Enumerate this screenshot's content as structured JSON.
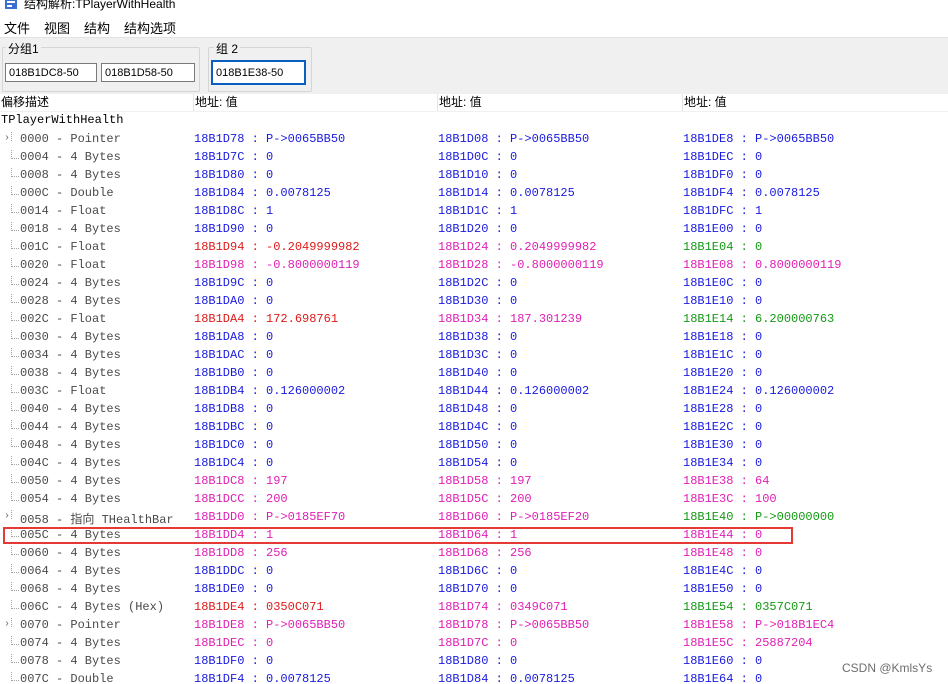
{
  "window": {
    "title": "结构解析:TPlayerWithHealth",
    "menu": [
      "文件",
      "视图",
      "结构",
      "结构选项"
    ]
  },
  "groups": [
    {
      "label": "分组1",
      "addresses": [
        "018B1DC8-50",
        "018B1D58-50"
      ]
    },
    {
      "label": "组 2",
      "addresses": [
        "018B1E38-50"
      ]
    }
  ],
  "columns": {
    "desc_header": "偏移描述",
    "value_headers": [
      "地址: 值",
      "地址: 值",
      "地址: 值"
    ]
  },
  "tree": {
    "root": "TPlayerWithHealth",
    "rows": [
      {
        "desc": "0000 - Pointer",
        "exp": true,
        "cells": [
          [
            "18B1D78 : P->0065BB50",
            "blue"
          ],
          [
            "18B1D08 : P->0065BB50",
            "blue"
          ],
          [
            "18B1DE8 : P->0065BB50",
            "blue"
          ]
        ]
      },
      {
        "desc": "0004 - 4 Bytes",
        "cells": [
          [
            "18B1D7C : 0",
            "blue"
          ],
          [
            "18B1D0C : 0",
            "blue"
          ],
          [
            "18B1DEC : 0",
            "blue"
          ]
        ]
      },
      {
        "desc": "0008 - 4 Bytes",
        "cells": [
          [
            "18B1D80 : 0",
            "blue"
          ],
          [
            "18B1D10 : 0",
            "blue"
          ],
          [
            "18B1DF0 : 0",
            "blue"
          ]
        ]
      },
      {
        "desc": "000C - Double",
        "cells": [
          [
            "18B1D84 : 0.0078125",
            "blue"
          ],
          [
            "18B1D14 : 0.0078125",
            "blue"
          ],
          [
            "18B1DF4 : 0.0078125",
            "blue"
          ]
        ]
      },
      {
        "desc": "0014 - Float",
        "cells": [
          [
            "18B1D8C : 1",
            "blue"
          ],
          [
            "18B1D1C : 1",
            "blue"
          ],
          [
            "18B1DFC : 1",
            "blue"
          ]
        ]
      },
      {
        "desc": "0018 - 4 Bytes",
        "cells": [
          [
            "18B1D90 : 0",
            "blue"
          ],
          [
            "18B1D20 : 0",
            "blue"
          ],
          [
            "18B1E00 : 0",
            "blue"
          ]
        ]
      },
      {
        "desc": "001C - Float",
        "cells": [
          [
            "18B1D94 : -0.2049999982",
            "red"
          ],
          [
            "18B1D24 : 0.2049999982",
            "pink"
          ],
          [
            "18B1E04 : 0",
            "green"
          ]
        ]
      },
      {
        "desc": "0020 - Float",
        "cells": [
          [
            "18B1D98 : -0.8000000119",
            "pink"
          ],
          [
            "18B1D28 : -0.8000000119",
            "pink"
          ],
          [
            "18B1E08 : 0.8000000119",
            "pink"
          ]
        ]
      },
      {
        "desc": "0024 - 4 Bytes",
        "cells": [
          [
            "18B1D9C : 0",
            "blue"
          ],
          [
            "18B1D2C : 0",
            "blue"
          ],
          [
            "18B1E0C : 0",
            "blue"
          ]
        ]
      },
      {
        "desc": "0028 - 4 Bytes",
        "cells": [
          [
            "18B1DA0 : 0",
            "blue"
          ],
          [
            "18B1D30 : 0",
            "blue"
          ],
          [
            "18B1E10 : 0",
            "blue"
          ]
        ]
      },
      {
        "desc": "002C - Float",
        "cells": [
          [
            "18B1DA4 : 172.698761",
            "red"
          ],
          [
            "18B1D34 : 187.301239",
            "pink"
          ],
          [
            "18B1E14 : 6.200000763",
            "green"
          ]
        ]
      },
      {
        "desc": "0030 - 4 Bytes",
        "cells": [
          [
            "18B1DA8 : 0",
            "blue"
          ],
          [
            "18B1D38 : 0",
            "blue"
          ],
          [
            "18B1E18 : 0",
            "blue"
          ]
        ]
      },
      {
        "desc": "0034 - 4 Bytes",
        "cells": [
          [
            "18B1DAC : 0",
            "blue"
          ],
          [
            "18B1D3C : 0",
            "blue"
          ],
          [
            "18B1E1C : 0",
            "blue"
          ]
        ]
      },
      {
        "desc": "0038 - 4 Bytes",
        "cells": [
          [
            "18B1DB0 : 0",
            "blue"
          ],
          [
            "18B1D40 : 0",
            "blue"
          ],
          [
            "18B1E20 : 0",
            "blue"
          ]
        ]
      },
      {
        "desc": "003C - Float",
        "cells": [
          [
            "18B1DB4 : 0.126000002",
            "blue"
          ],
          [
            "18B1D44 : 0.126000002",
            "blue"
          ],
          [
            "18B1E24 : 0.126000002",
            "blue"
          ]
        ]
      },
      {
        "desc": "0040 - 4 Bytes",
        "cells": [
          [
            "18B1DB8 : 0",
            "blue"
          ],
          [
            "18B1D48 : 0",
            "blue"
          ],
          [
            "18B1E28 : 0",
            "blue"
          ]
        ]
      },
      {
        "desc": "0044 - 4 Bytes",
        "cells": [
          [
            "18B1DBC : 0",
            "blue"
          ],
          [
            "18B1D4C : 0",
            "blue"
          ],
          [
            "18B1E2C : 0",
            "blue"
          ]
        ]
      },
      {
        "desc": "0048 - 4 Bytes",
        "cells": [
          [
            "18B1DC0 : 0",
            "blue"
          ],
          [
            "18B1D50 : 0",
            "blue"
          ],
          [
            "18B1E30 : 0",
            "blue"
          ]
        ]
      },
      {
        "desc": "004C - 4 Bytes",
        "cells": [
          [
            "18B1DC4 : 0",
            "blue"
          ],
          [
            "18B1D54 : 0",
            "blue"
          ],
          [
            "18B1E34 : 0",
            "blue"
          ]
        ]
      },
      {
        "desc": "0050 - 4 Bytes",
        "cells": [
          [
            "18B1DC8 : 197",
            "pink"
          ],
          [
            "18B1D58 : 197",
            "pink"
          ],
          [
            "18B1E38 : 64",
            "pink"
          ]
        ]
      },
      {
        "desc": "0054 - 4 Bytes",
        "cells": [
          [
            "18B1DCC : 200",
            "pink"
          ],
          [
            "18B1D5C : 200",
            "pink"
          ],
          [
            "18B1E3C : 100",
            "pink"
          ]
        ]
      },
      {
        "desc": "0058 - 指向 THealthBar",
        "exp": true,
        "cells": [
          [
            "18B1DD0 : P->0185EF70",
            "pink"
          ],
          [
            "18B1D60 : P->0185EF20",
            "pink"
          ],
          [
            "18B1E40 : P->00000000",
            "green"
          ]
        ]
      },
      {
        "desc": "005C - 4 Bytes",
        "cells": [
          [
            "18B1DD4 : 1",
            "pink"
          ],
          [
            "18B1D64 : 1",
            "pink"
          ],
          [
            "18B1E44 : 0",
            "pink"
          ]
        ]
      },
      {
        "desc": "0060 - 4 Bytes",
        "cells": [
          [
            "18B1DD8 : 256",
            "pink"
          ],
          [
            "18B1D68 : 256",
            "pink"
          ],
          [
            "18B1E48 : 0",
            "pink"
          ]
        ]
      },
      {
        "desc": "0064 - 4 Bytes",
        "cells": [
          [
            "18B1DDC : 0",
            "blue"
          ],
          [
            "18B1D6C : 0",
            "blue"
          ],
          [
            "18B1E4C : 0",
            "blue"
          ]
        ]
      },
      {
        "desc": "0068 - 4 Bytes",
        "cells": [
          [
            "18B1DE0 : 0",
            "blue"
          ],
          [
            "18B1D70 : 0",
            "blue"
          ],
          [
            "18B1E50 : 0",
            "blue"
          ]
        ]
      },
      {
        "desc": "006C - 4 Bytes (Hex)",
        "cells": [
          [
            "18B1DE4 : 0350C071",
            "red"
          ],
          [
            "18B1D74 : 0349C071",
            "pink"
          ],
          [
            "18B1E54 : 0357C071",
            "green"
          ]
        ]
      },
      {
        "desc": "0070 - Pointer",
        "exp": true,
        "cells": [
          [
            "18B1DE8 : P->0065BB50",
            "pink"
          ],
          [
            "18B1D78 : P->0065BB50",
            "pink"
          ],
          [
            "18B1E58 : P->018B1EC4",
            "pink"
          ]
        ]
      },
      {
        "desc": "0074 - 4 Bytes",
        "cells": [
          [
            "18B1DEC : 0",
            "pink"
          ],
          [
            "18B1D7C : 0",
            "pink"
          ],
          [
            "18B1E5C : 25887204",
            "pink"
          ]
        ]
      },
      {
        "desc": "0078 - 4 Bytes",
        "cells": [
          [
            "18B1DF0 : 0",
            "blue"
          ],
          [
            "18B1D80 : 0",
            "blue"
          ],
          [
            "18B1E60 : 0",
            "blue"
          ]
        ]
      },
      {
        "desc": "007C - Double",
        "cells": [
          [
            "18B1DF4 : 0.0078125",
            "blue"
          ],
          [
            "18B1D84 : 0.0078125",
            "blue"
          ],
          [
            "18B1E64 : 0",
            "blue"
          ]
        ]
      }
    ]
  },
  "watermark": "CSDN @KmlsYs",
  "colors": {
    "blue": "#1a1ae0",
    "pink": "#e01fb5",
    "red": "#e01919",
    "green": "#149a14",
    "highlight": "#e53935"
  }
}
